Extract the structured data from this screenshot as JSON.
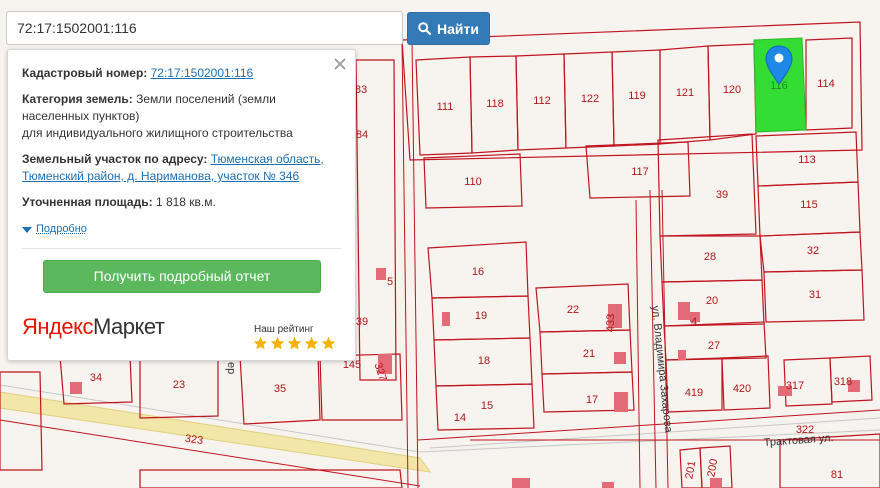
{
  "search": {
    "query": "72:17:1502001:116",
    "button_label": "Найти"
  },
  "popup": {
    "cadastral_label": "Кадастровый номер:",
    "cadastral_value": "72:17:1502001:116",
    "category_label": "Категория земель:",
    "category_value_line1": "Земли поселений (земли",
    "category_value_line2": "населенных пунктов)",
    "category_value_line3": "для индивидуального жилищного строительства",
    "address_label": "Земельный участок по адресу:",
    "address_value_line1": "Тюменская область,",
    "address_value_line2": "Тюменский район, д. Нариманова, участок № 346",
    "area_label": "Уточненная площадь:",
    "area_value": "1 818 кв.м.",
    "more_label": "Подробно",
    "report_button": "Получить подробный отчет",
    "market_logo_part1": "Яндекс",
    "market_logo_part2": "Маркет",
    "rating_label": "Наш рейтинг",
    "rating_stars": 5
  },
  "map": {
    "parcels": [
      "111",
      "118",
      "112",
      "122",
      "119",
      "121",
      "120",
      "116",
      "114",
      "113",
      "117",
      "110",
      "39",
      "115",
      "32",
      "28",
      "16",
      "31",
      "20",
      "19",
      "22",
      "433",
      "4",
      "27",
      "18",
      "21",
      "15",
      "17",
      "419",
      "420",
      "317",
      "318",
      "83",
      "84",
      "145",
      "327",
      "5",
      "39",
      "34",
      "23",
      "35",
      "201",
      "200",
      "81",
      "322",
      "323",
      "14"
    ],
    "streets": [
      "ул. Владимира Захарова",
      "Трактовая ул.",
      "ер"
    ],
    "accent_selected": "#33dd33",
    "parcel_line_color": "#c0141e",
    "marker_color": "#1e88e5"
  }
}
